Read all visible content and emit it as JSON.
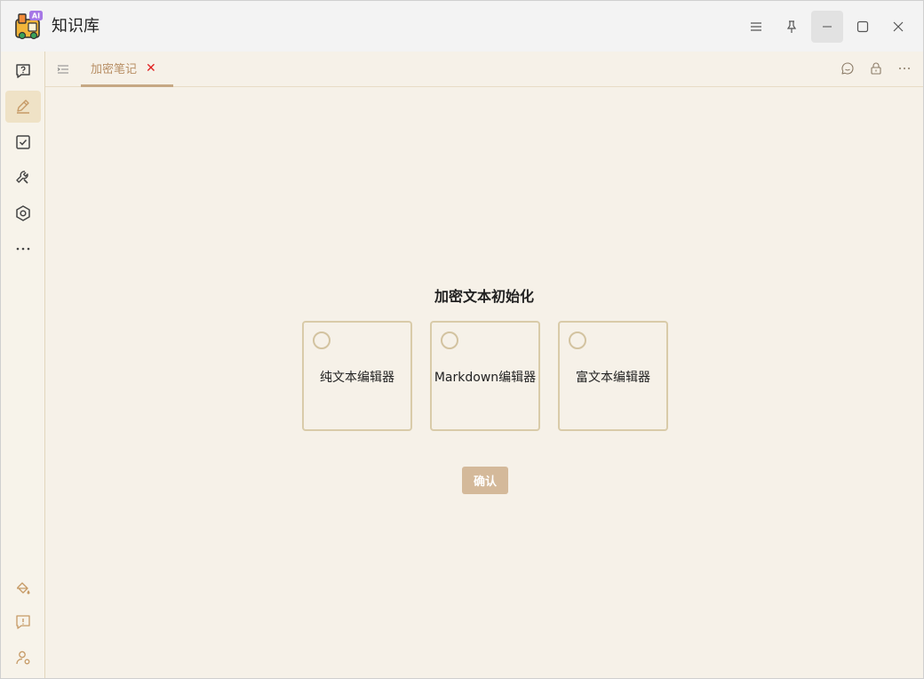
{
  "app": {
    "title": "知识库",
    "logo_badge": "AI"
  },
  "window_controls": {
    "menu_icon": "hamburger-icon",
    "pin_icon": "pin-icon",
    "minimize_icon": "minimize-icon",
    "maximize_icon": "maximize-icon",
    "close_icon": "close-icon"
  },
  "rail": {
    "items": [
      {
        "icon": "chat-question-icon"
      },
      {
        "icon": "edit-pencil-icon",
        "active": true
      },
      {
        "icon": "checkbox-icon"
      },
      {
        "icon": "tools-icon"
      },
      {
        "icon": "hexagon-settings-icon"
      },
      {
        "icon": "more-horizontal-icon"
      }
    ],
    "bottom_items": [
      {
        "icon": "paint-bucket-icon"
      },
      {
        "icon": "feedback-icon"
      },
      {
        "icon": "user-settings-icon"
      }
    ]
  },
  "tabbar": {
    "toggle_icon": "list-indent-icon",
    "tab_label": "加密笔记",
    "tab_close": "✕",
    "tools": [
      "chat-bubble-icon",
      "lock-icon",
      "more-horizontal-icon"
    ]
  },
  "init": {
    "title": "加密文本初始化",
    "options": [
      {
        "label": "纯文本编辑器"
      },
      {
        "label": "Markdown编辑器"
      },
      {
        "label": "富文本编辑器"
      }
    ],
    "confirm_label": "确认"
  },
  "colors": {
    "accent": "#c6a884",
    "tab_text": "#b88f65",
    "close_red": "#e02020",
    "card_border": "#d9cba9",
    "confirm_bg": "#d4b99a",
    "main_bg": "#f6f1e8"
  }
}
